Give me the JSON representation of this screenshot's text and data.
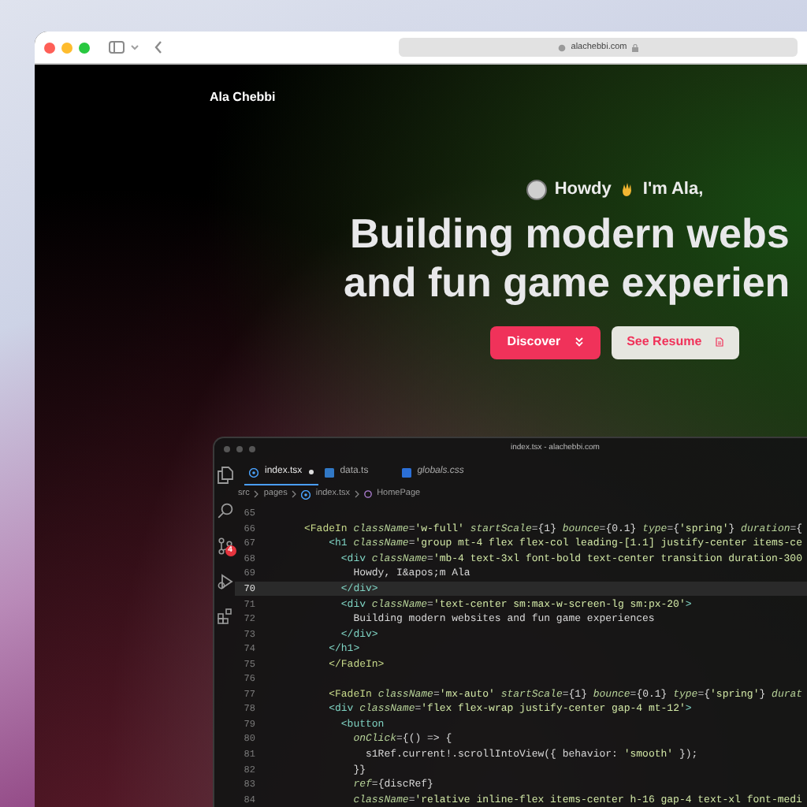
{
  "browser": {
    "url": "alachebbi.com"
  },
  "site": {
    "brand": "Ala Chebbi",
    "greeting": [
      "Howdy",
      "I'm Ala,"
    ],
    "headline": [
      "Building modern webs",
      "and fun game experien"
    ],
    "buttons": [
      {
        "label": "Discover",
        "kind": "primary"
      },
      {
        "label": "See Resume",
        "kind": "secondary"
      }
    ]
  },
  "editor": {
    "title": "index.tsx - alachebbi.com",
    "source_control_badge": "4",
    "tabs": [
      {
        "label": "index.tsx",
        "kind": "react",
        "selected": true,
        "modified": true,
        "preview": false
      },
      {
        "label": "data.ts",
        "kind": "ts",
        "selected": false,
        "modified": false,
        "preview": false
      },
      {
        "label": "globals.css",
        "kind": "css",
        "selected": false,
        "modified": false,
        "preview": true
      }
    ],
    "breadcrumb": [
      "src",
      "pages",
      "index.tsx",
      "HomePage"
    ],
    "lines": [
      {
        "number": "65",
        "current": false
      },
      {
        "number": "66",
        "current": false,
        "tokens": [
          {
            "text": "<FadeIn",
            "kind": "component"
          },
          {
            "text": " className",
            "kind": "attr"
          },
          {
            "text": "=",
            "kind": "plain"
          },
          {
            "text": "'w-full'",
            "kind": "str"
          },
          {
            "text": " startScale",
            "kind": "attr"
          },
          {
            "text": "={1}",
            "kind": "plain"
          },
          {
            "text": " bounce",
            "kind": "attr"
          },
          {
            "text": "={0.1}",
            "kind": "plain"
          },
          {
            "text": " type",
            "kind": "attr"
          },
          {
            "text": "={",
            "kind": "plain"
          },
          {
            "text": "'spring'",
            "kind": "str"
          },
          {
            "text": "}",
            "kind": "plain"
          },
          {
            "text": " duration",
            "kind": "attr"
          },
          {
            "text": "={",
            "kind": "plain"
          }
        ]
      },
      {
        "number": "67",
        "current": false,
        "tokens": [
          {
            "text": "    <h1",
            "kind": "tag"
          },
          {
            "text": " className",
            "kind": "attr"
          },
          {
            "text": "=",
            "kind": "plain"
          },
          {
            "text": "'group mt-4 flex flex-col leading-[1.1] justify-center items-ce",
            "kind": "str"
          }
        ]
      },
      {
        "number": "68",
        "current": false,
        "tokens": [
          {
            "text": "      <div",
            "kind": "tag"
          },
          {
            "text": " className",
            "kind": "attr"
          },
          {
            "text": "=",
            "kind": "plain"
          },
          {
            "text": "'mb-4 text-3xl font-bold text-center transition duration-300",
            "kind": "str"
          }
        ]
      },
      {
        "number": "69",
        "current": false,
        "tokens": [
          {
            "text": "        Howdy, I&apos;m Ala",
            "kind": "plain"
          }
        ]
      },
      {
        "number": "70",
        "current": true,
        "tokens": [
          {
            "text": "      </div>",
            "kind": "tag"
          }
        ]
      },
      {
        "number": "71",
        "current": false,
        "tokens": [
          {
            "text": "      <div",
            "kind": "tag"
          },
          {
            "text": " className",
            "kind": "attr"
          },
          {
            "text": "=",
            "kind": "plain"
          },
          {
            "text": "'text-center sm:max-w-screen-lg sm:px-20'",
            "kind": "str"
          },
          {
            "text": ">",
            "kind": "tag"
          }
        ]
      },
      {
        "number": "72",
        "current": false,
        "tokens": [
          {
            "text": "        Building modern websites and fun game experiences",
            "kind": "plain"
          }
        ]
      },
      {
        "number": "73",
        "current": false,
        "tokens": [
          {
            "text": "      </div>",
            "kind": "tag"
          }
        ]
      },
      {
        "number": "74",
        "current": false,
        "tokens": [
          {
            "text": "    </h1>",
            "kind": "tag"
          }
        ]
      },
      {
        "number": "75",
        "current": false,
        "tokens": [
          {
            "text": "    </FadeIn>",
            "kind": "component"
          }
        ]
      },
      {
        "number": "76",
        "current": false
      },
      {
        "number": "77",
        "current": false,
        "tokens": [
          {
            "text": "    <FadeIn",
            "kind": "component"
          },
          {
            "text": " className",
            "kind": "attr"
          },
          {
            "text": "=",
            "kind": "plain"
          },
          {
            "text": "'mx-auto'",
            "kind": "str"
          },
          {
            "text": " startScale",
            "kind": "attr"
          },
          {
            "text": "={1}",
            "kind": "plain"
          },
          {
            "text": " bounce",
            "kind": "attr"
          },
          {
            "text": "={0.1}",
            "kind": "plain"
          },
          {
            "text": " type",
            "kind": "attr"
          },
          {
            "text": "={",
            "kind": "plain"
          },
          {
            "text": "'spring'",
            "kind": "str"
          },
          {
            "text": "}",
            "kind": "plain"
          },
          {
            "text": " durat",
            "kind": "attr"
          }
        ]
      },
      {
        "number": "78",
        "current": false,
        "tokens": [
          {
            "text": "    <div",
            "kind": "tag"
          },
          {
            "text": " className",
            "kind": "attr"
          },
          {
            "text": "=",
            "kind": "plain"
          },
          {
            "text": "'flex flex-wrap justify-center gap-4 mt-12'",
            "kind": "str"
          },
          {
            "text": ">",
            "kind": "tag"
          }
        ]
      },
      {
        "number": "79",
        "current": false,
        "tokens": [
          {
            "text": "      <button",
            "kind": "tag"
          }
        ]
      },
      {
        "number": "80",
        "current": false,
        "tokens": [
          {
            "text": "        onClick",
            "kind": "attr"
          },
          {
            "text": "={() => {",
            "kind": "plain"
          }
        ]
      },
      {
        "number": "81",
        "current": false,
        "tokens": [
          {
            "text": "          s1Ref.current!.scrollIntoView({ behavior: ",
            "kind": "plain"
          },
          {
            "text": "'smooth'",
            "kind": "str"
          },
          {
            "text": " });",
            "kind": "plain"
          }
        ]
      },
      {
        "number": "82",
        "current": false,
        "tokens": [
          {
            "text": "        }}",
            "kind": "plain"
          }
        ]
      },
      {
        "number": "83",
        "current": false,
        "tokens": [
          {
            "text": "        ref",
            "kind": "attr"
          },
          {
            "text": "={discRef}",
            "kind": "plain"
          }
        ]
      },
      {
        "number": "84",
        "current": false,
        "tokens": [
          {
            "text": "        className",
            "kind": "attr"
          },
          {
            "text": "=",
            "kind": "plain"
          },
          {
            "text": "'relative inline-flex items-center h-16 gap-4 text-xl font-medi",
            "kind": "str"
          }
        ]
      }
    ]
  }
}
